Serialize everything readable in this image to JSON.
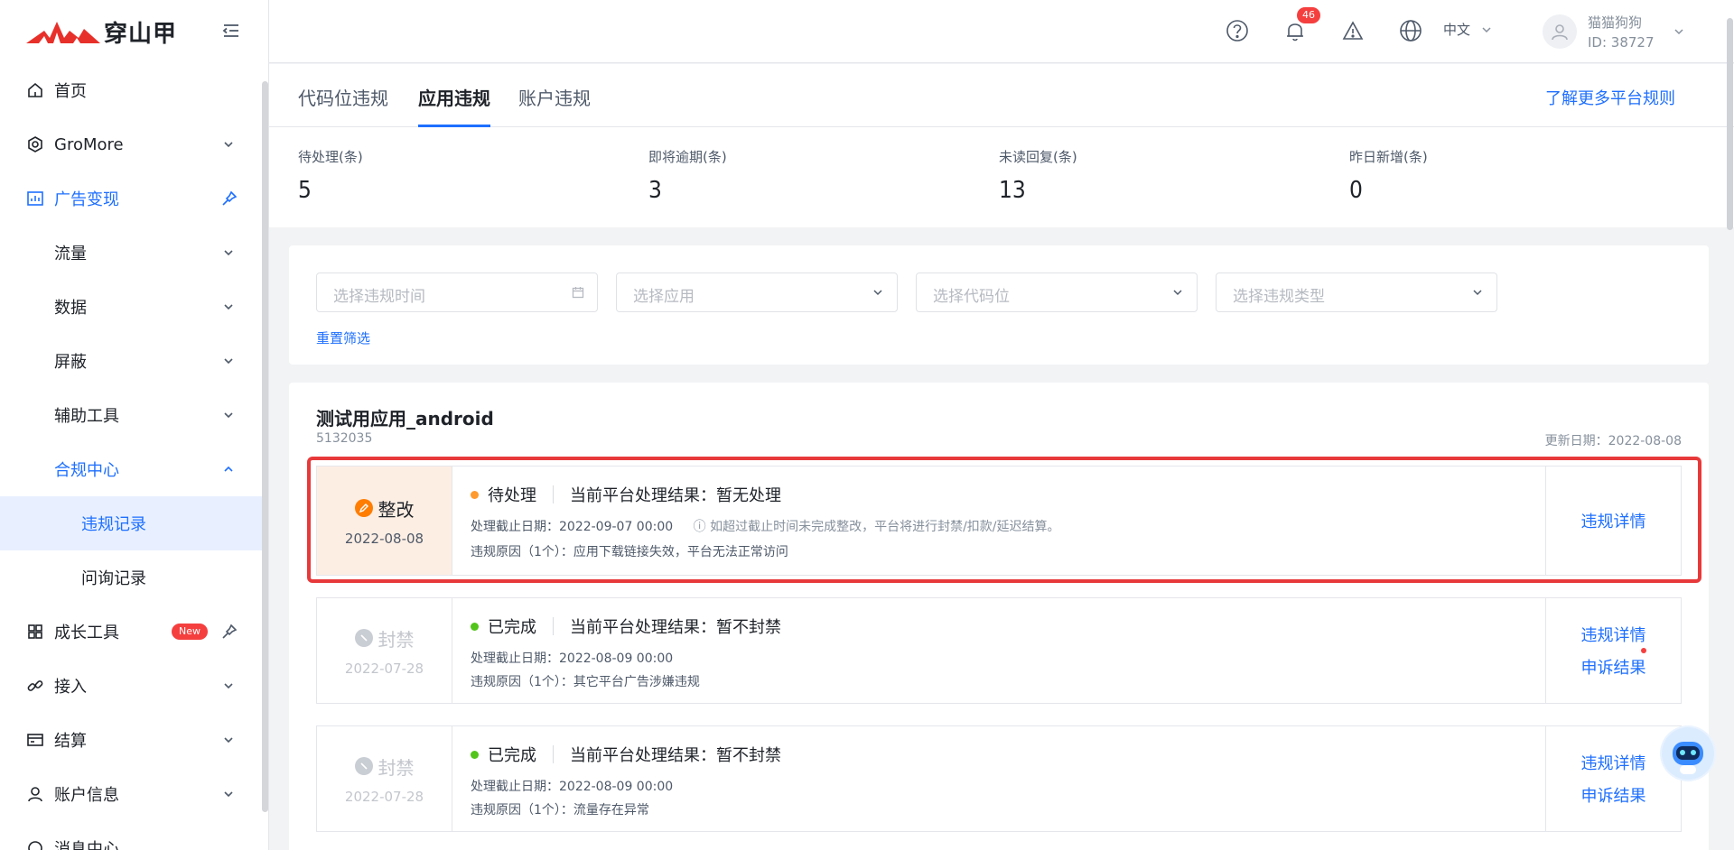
{
  "brand": {
    "name": "穿山甲"
  },
  "sidebar": {
    "items": [
      {
        "label": "首页",
        "icon": "home-icon"
      },
      {
        "label": "GroMore",
        "icon": "gromore-icon"
      },
      {
        "label": "广告变现",
        "icon": "chart-icon"
      },
      {
        "label": "流量"
      },
      {
        "label": "数据"
      },
      {
        "label": "屏蔽"
      },
      {
        "label": "辅助工具"
      },
      {
        "label": "合规中心"
      },
      {
        "label": "违规记录"
      },
      {
        "label": "问询记录"
      },
      {
        "label": "成长工具",
        "icon": "grid-icon",
        "badge": "New"
      },
      {
        "label": "接入",
        "icon": "link-icon"
      },
      {
        "label": "结算",
        "icon": "card-icon"
      },
      {
        "label": "账户信息",
        "icon": "user-icon"
      },
      {
        "label": "消息中心",
        "icon": "message-icon"
      }
    ]
  },
  "header": {
    "notification_count": "46",
    "language": "中文",
    "user_name": "猫猫狗狗",
    "user_id": "ID: 38727"
  },
  "tabs": [
    {
      "label": "代码位违规"
    },
    {
      "label": "应用违规"
    },
    {
      "label": "账户违规"
    }
  ],
  "rules_link": "了解更多平台规则",
  "stats": [
    {
      "label": "待处理(条)",
      "value": "5"
    },
    {
      "label": "即将逾期(条)",
      "value": "3"
    },
    {
      "label": "未读回复(条)",
      "value": "13"
    },
    {
      "label": "昨日新增(条)",
      "value": "0"
    }
  ],
  "filters": {
    "time_placeholder": "选择违规时间",
    "app_placeholder": "选择应用",
    "slot_placeholder": "选择代码位",
    "type_placeholder": "选择违规类型",
    "reset": "重置筛选"
  },
  "app": {
    "title": "测试用应用_android",
    "id": "5132035",
    "update_date": "更新日期：2022-08-08"
  },
  "records": [
    {
      "tag": "整改",
      "date": "2022-08-08",
      "status": "待处理",
      "status_color": "#ff9a2e",
      "result": "当前平台处理结果：暂无处理",
      "deadline": "处理截止日期：2022-09-07 00:00",
      "warning": "如超过截止时间未完成整改，平台将进行封禁/扣款/延迟结算。",
      "reason": "违规原因（1个）：应用下载链接失效，平台无法正常访问",
      "actions": [
        "违规详情"
      ]
    },
    {
      "tag": "封禁",
      "date": "2022-07-28",
      "status": "已完成",
      "status_color": "#52c41a",
      "result": "当前平台处理结果：暂不封禁",
      "deadline": "处理截止日期：2022-08-09 00:00",
      "reason": "违规原因（1个）：其它平台广告涉嫌违规",
      "actions": [
        "违规详情",
        "申诉结果"
      ]
    },
    {
      "tag": "封禁",
      "date": "2022-07-28",
      "status": "已完成",
      "status_color": "#52c41a",
      "result": "当前平台处理结果：暂不封禁",
      "deadline": "处理截止日期：2022-08-09 00:00",
      "reason": "违规原因（1个）：流量存在异常",
      "actions": [
        "违规详情",
        "申诉结果"
      ]
    }
  ],
  "colors": {
    "accent": "#1e6fff",
    "highlight": "#e8393a",
    "brand_red": "#e8302a"
  }
}
